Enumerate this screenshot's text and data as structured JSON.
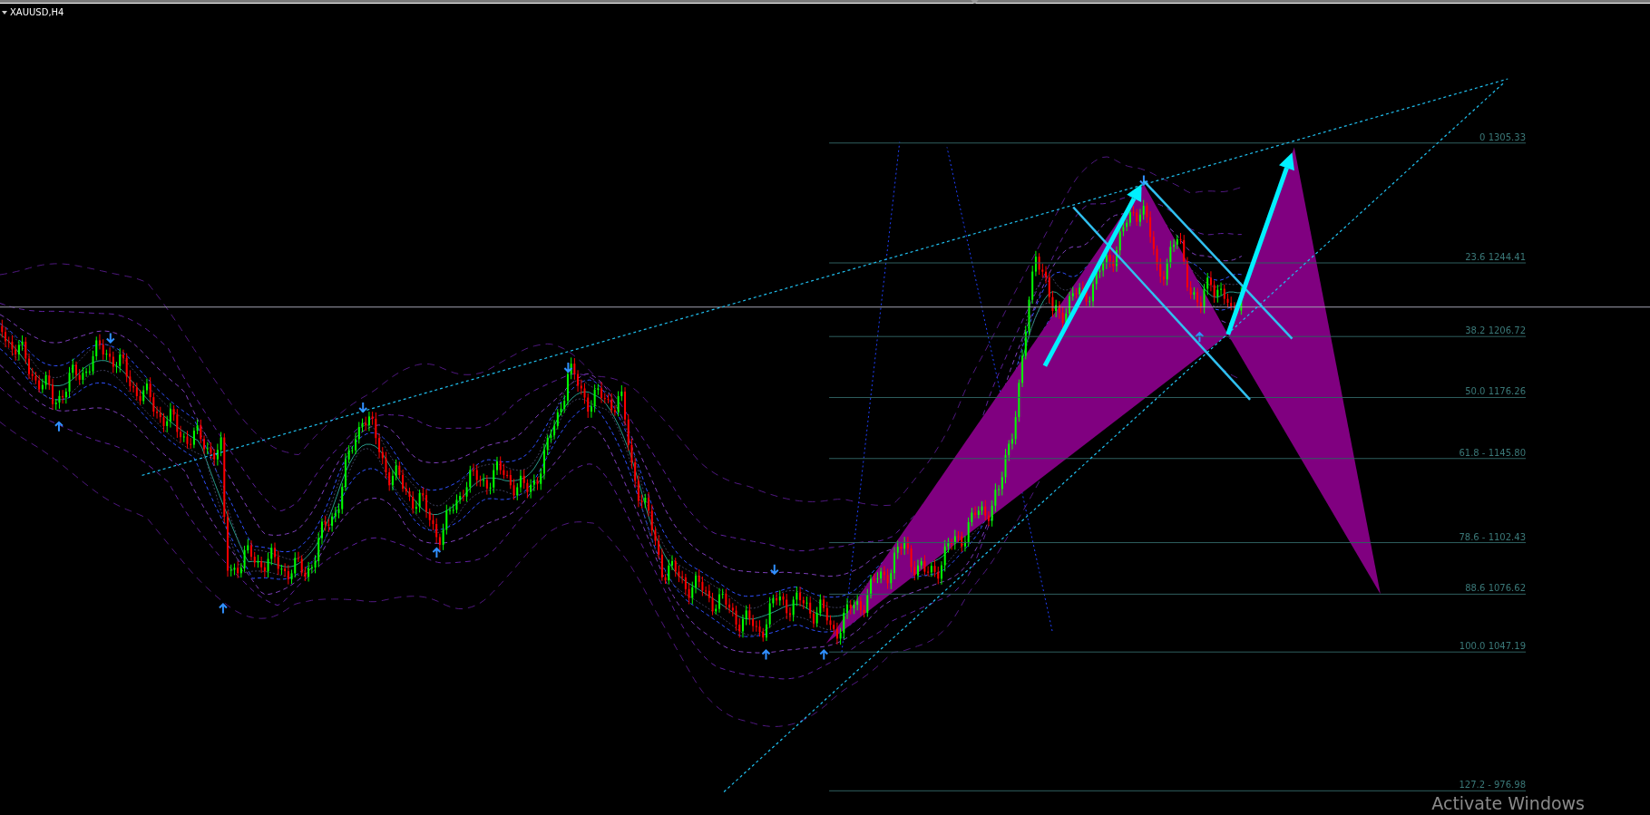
{
  "chart": {
    "title": "XAUUSD,H4",
    "fibonacci_levels": [
      {
        "label": "0 1305.33"
      },
      {
        "label": "23.6 1244.41"
      },
      {
        "label": "38.2 1206.72"
      },
      {
        "label": "50.0 1176.26"
      },
      {
        "label": "61.8 - 1145.80"
      },
      {
        "label": "78.6 - 1102.43"
      },
      {
        "label": "88.6 1076.62"
      },
      {
        "label": "100.0 1047.19"
      },
      {
        "label": "127.2 - 976.98"
      }
    ]
  },
  "os_notice": {
    "text": "Activate Windows"
  }
}
